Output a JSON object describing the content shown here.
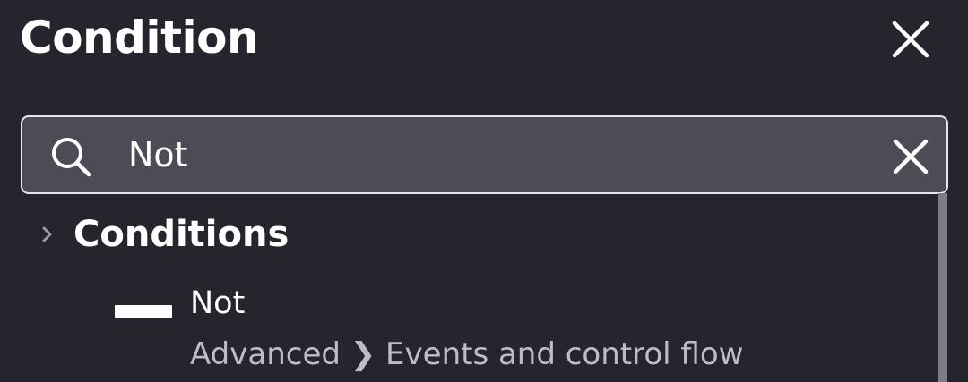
{
  "header": {
    "title": "Condition",
    "close_icon": "close-icon"
  },
  "search": {
    "value": "Not",
    "icon": "search-icon",
    "clear_icon": "clear-icon"
  },
  "results": {
    "group": {
      "label": "Conditions",
      "expanded": false,
      "icon": "chevron-right-icon"
    },
    "items": [
      {
        "title": "Not",
        "path": "Advanced ❯ Events and control flow",
        "icon": "dash-icon"
      }
    ]
  },
  "colors": {
    "background": "#25252d",
    "search_background": "#4c4c56",
    "search_border": "#e6e6ee",
    "text_primary": "#ffffff",
    "text_secondary": "#bdbdc4",
    "scrollbar": "#7d7d85"
  }
}
